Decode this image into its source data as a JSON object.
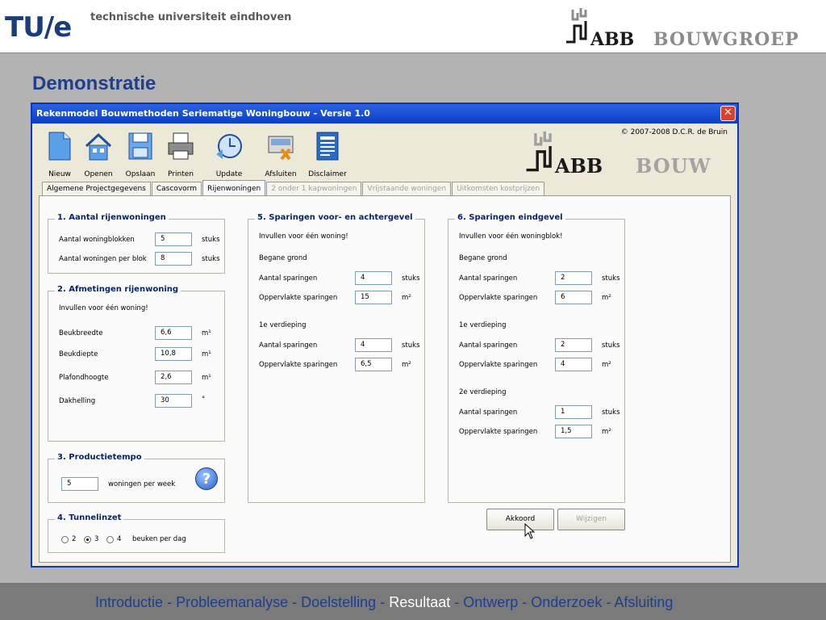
{
  "slide": {
    "university_short": "TU/e",
    "university_name": "technische universiteit eindhoven",
    "partner_abb": "ABB",
    "partner_bouwgroep": "BOUWGROEP",
    "title": "Demonstratie"
  },
  "window": {
    "title": "Rekenmodel Bouwmethoden Seriematige Woningbouw  -  Versie 1.0",
    "close_glyph": "✕",
    "copyright": "© 2007-2008 D.C.R. de Bruin",
    "logo_abb": "ABB",
    "logo_bouw": "BOUW"
  },
  "toolbar": {
    "nieuw": "Nieuw",
    "openen": "Openen",
    "opslaan": "Opslaan",
    "printen": "Printen",
    "update": "Update",
    "afsluiten": "Afsluiten",
    "disclaimer": "Disclaimer"
  },
  "tabs": {
    "algemeen": "Algemene Projectgegevens",
    "cascovorm": "Cascovorm",
    "rijenwoningen": "Rijenwoningen",
    "twee_onder_een": "2 onder 1 kapwoningen",
    "vrijstaande": "Vrijstaande woningen",
    "uitkomsten": "Uitkomsten kostprijzen"
  },
  "g1": {
    "title": "1. Aantal rijenwoningen",
    "r1_label": "Aantal woningblokken",
    "r1_value": "5",
    "r1_unit": "stuks",
    "r2_label": "Aantal woningen per blok",
    "r2_value": "8",
    "r2_unit": "stuks"
  },
  "g2": {
    "title": "2. Afmetingen rijenwoning",
    "note": "Invullen voor één woning!",
    "r1_label": "Beukbreedte",
    "r1_value": "6,6",
    "r1_unit": "m¹",
    "r2_label": "Beukdiepte",
    "r2_value": "10,8",
    "r2_unit": "m¹",
    "r3_label": "Plafondhoogte",
    "r3_value": "2,6",
    "r3_unit": "m¹",
    "r4_label": "Dakhelling",
    "r4_value": "30",
    "r4_unit": "°"
  },
  "g3": {
    "title": "3. Productietempo",
    "value": "5",
    "unit": "woningen per week",
    "help_glyph": "?"
  },
  "g4": {
    "title": "4. Tunnelinzet",
    "opt1": "2",
    "opt2": "3",
    "opt3": "4",
    "selected": "3",
    "unit": "beuken per dag"
  },
  "g5": {
    "title": "5. Sparingen voor- en achtergevel",
    "note": "Invullen voor één woning!",
    "floor1": "Begane grond",
    "f1_count_label": "Aantal sparingen",
    "f1_count": "4",
    "f1_count_unit": "stuks",
    "f1_area_label": "Oppervlakte sparingen",
    "f1_area": "15",
    "f1_area_unit": "m²",
    "floor2": "1e verdieping",
    "f2_count_label": "Aantal sparingen",
    "f2_count": "4",
    "f2_count_unit": "stuks",
    "f2_area_label": "Oppervlakte sparingen",
    "f2_area": "6,5",
    "f2_area_unit": "m²"
  },
  "g6": {
    "title": "6. Sparingen eindgevel",
    "note": "Invullen voor één woningblok!",
    "floor1": "Begane grond",
    "f1_count_label": "Aantal sparingen",
    "f1_count": "2",
    "f1_count_unit": "stuks",
    "f1_area_label": "Oppervlakte sparingen",
    "f1_area": "6",
    "f1_area_unit": "m²",
    "floor2": "1e verdieping",
    "f2_count_label": "Aantal sparingen",
    "f2_count": "2",
    "f2_count_unit": "stuks",
    "f2_area_label": "Oppervlakte sparingen",
    "f2_area": "4",
    "f2_area_unit": "m²",
    "floor3": "2e verdieping",
    "f3_count_label": "Aantal sparingen",
    "f3_count": "1",
    "f3_count_unit": "stuks",
    "f3_area_label": "Oppervlakte sparingen",
    "f3_area": "1,5",
    "f3_area_unit": "m²"
  },
  "buttons": {
    "akkoord": "Akkoord",
    "wijzigen": "Wijzigen"
  },
  "nav": {
    "introductie": "Introductie",
    "probleemanalyse": "Probleemanalyse",
    "doelstelling": "Doelstelling",
    "resultaat": "Resultaat",
    "ontwerp": "Ontwerp",
    "onderzoek": "Onderzoek",
    "afsluiting": "Afsluiting",
    "separator": " - "
  },
  "colors": {
    "title_blue": "#1f3e8c",
    "titlebar_blue": "#0a3fc6",
    "group_title": "#0a246a",
    "footer_gray": "#7a7a7a"
  }
}
